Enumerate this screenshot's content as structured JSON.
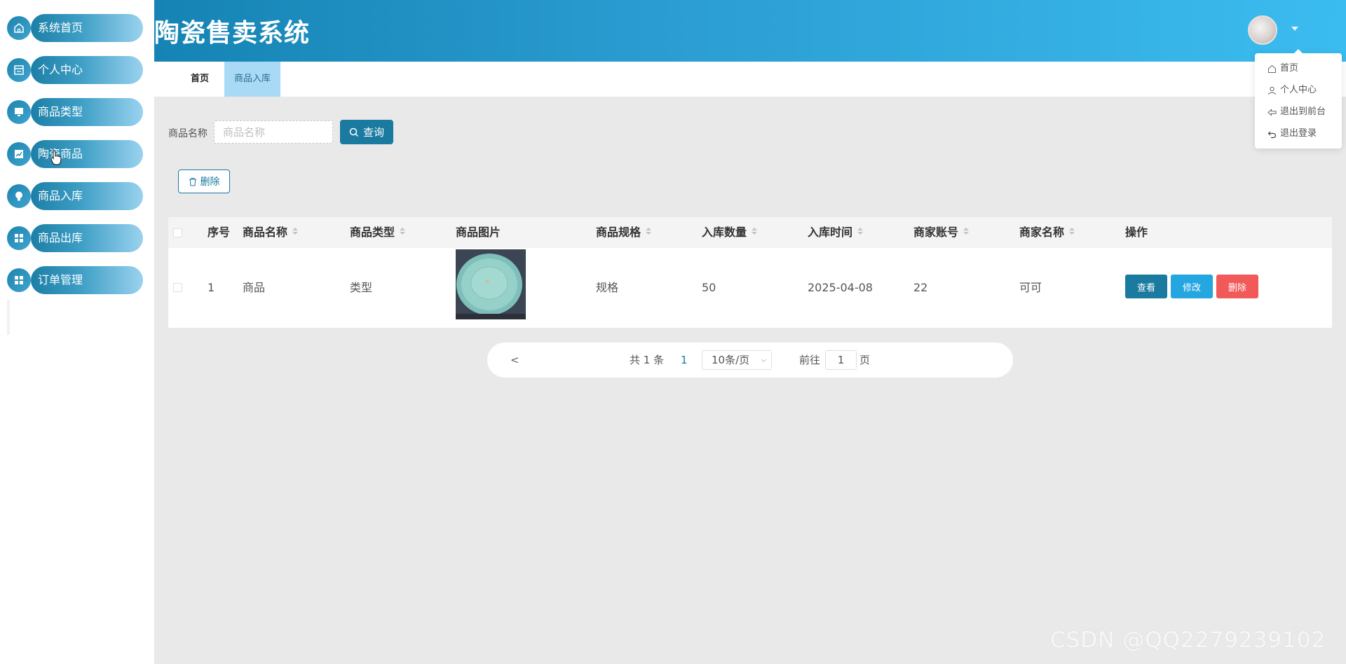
{
  "app": {
    "title": "陶瓷售卖系统"
  },
  "sidebar": {
    "items": [
      {
        "label": "系统首页",
        "icon": "home-icon"
      },
      {
        "label": "个人中心",
        "icon": "profile-card-icon"
      },
      {
        "label": "商品类型",
        "icon": "monitor-icon"
      },
      {
        "label": "陶瓷商品",
        "icon": "chart-icon"
      },
      {
        "label": "商品入库",
        "icon": "bulb-icon"
      },
      {
        "label": "商品出库",
        "icon": "grid-icon"
      },
      {
        "label": "订单管理",
        "icon": "grid-icon"
      }
    ]
  },
  "tabs": {
    "home": "首页",
    "active": "商品入库"
  },
  "user_menu": {
    "items": [
      {
        "label": "首页",
        "icon": "home-icon"
      },
      {
        "label": "个人中心",
        "icon": "user-icon"
      },
      {
        "label": "退出到前台",
        "icon": "back-arrow-icon"
      },
      {
        "label": "退出登录",
        "icon": "logout-icon"
      }
    ]
  },
  "search": {
    "label": "商品名称",
    "placeholder": "商品名称",
    "button": "查询"
  },
  "toolbar": {
    "delete_label": "删除"
  },
  "table": {
    "columns": [
      "序号",
      "商品名称",
      "商品类型",
      "商品图片",
      "商品规格",
      "入库数量",
      "入库时间",
      "商家账号",
      "商家名称",
      "操作"
    ],
    "rows": [
      {
        "index": "1",
        "name": "商品",
        "type": "类型",
        "spec": "规格",
        "quantity": "50",
        "time": "2025-04-08",
        "account": "22",
        "merchant": "可可"
      }
    ],
    "actions": {
      "view": "查看",
      "edit": "修改",
      "delete": "删除"
    }
  },
  "pagination": {
    "prev": "<",
    "total": "共 1 条",
    "current_page": "1",
    "page_size": "10条/页",
    "goto_label": "前往",
    "goto_value": "1",
    "goto_suffix": "页"
  },
  "watermark": "CSDN @QQ2279239102",
  "colors": {
    "primary": "#1a7aa0",
    "edit": "#24a6e0",
    "danger": "#f25a5a",
    "header_start": "#1584b4",
    "header_end": "#3bbcf0"
  }
}
